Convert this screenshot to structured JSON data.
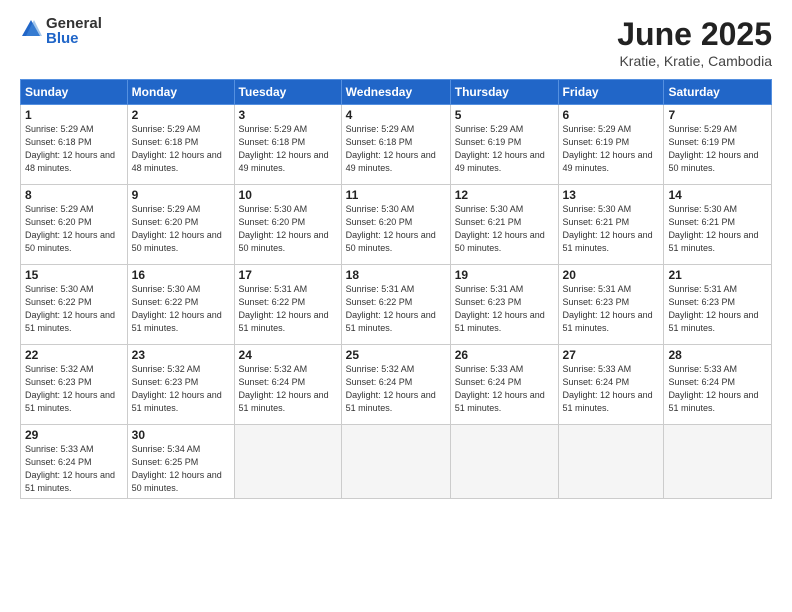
{
  "logo": {
    "general": "General",
    "blue": "Blue"
  },
  "title": "June 2025",
  "subtitle": "Kratie, Kratie, Cambodia",
  "headers": [
    "Sunday",
    "Monday",
    "Tuesday",
    "Wednesday",
    "Thursday",
    "Friday",
    "Saturday"
  ],
  "weeks": [
    [
      {
        "day": "1",
        "rise": "5:29 AM",
        "set": "6:18 PM",
        "daylight": "12 hours and 48 minutes."
      },
      {
        "day": "2",
        "rise": "5:29 AM",
        "set": "6:18 PM",
        "daylight": "12 hours and 48 minutes."
      },
      {
        "day": "3",
        "rise": "5:29 AM",
        "set": "6:18 PM",
        "daylight": "12 hours and 49 minutes."
      },
      {
        "day": "4",
        "rise": "5:29 AM",
        "set": "6:18 PM",
        "daylight": "12 hours and 49 minutes."
      },
      {
        "day": "5",
        "rise": "5:29 AM",
        "set": "6:19 PM",
        "daylight": "12 hours and 49 minutes."
      },
      {
        "day": "6",
        "rise": "5:29 AM",
        "set": "6:19 PM",
        "daylight": "12 hours and 49 minutes."
      },
      {
        "day": "7",
        "rise": "5:29 AM",
        "set": "6:19 PM",
        "daylight": "12 hours and 50 minutes."
      }
    ],
    [
      {
        "day": "8",
        "rise": "5:29 AM",
        "set": "6:20 PM",
        "daylight": "12 hours and 50 minutes."
      },
      {
        "day": "9",
        "rise": "5:29 AM",
        "set": "6:20 PM",
        "daylight": "12 hours and 50 minutes."
      },
      {
        "day": "10",
        "rise": "5:30 AM",
        "set": "6:20 PM",
        "daylight": "12 hours and 50 minutes."
      },
      {
        "day": "11",
        "rise": "5:30 AM",
        "set": "6:20 PM",
        "daylight": "12 hours and 50 minutes."
      },
      {
        "day": "12",
        "rise": "5:30 AM",
        "set": "6:21 PM",
        "daylight": "12 hours and 50 minutes."
      },
      {
        "day": "13",
        "rise": "5:30 AM",
        "set": "6:21 PM",
        "daylight": "12 hours and 51 minutes."
      },
      {
        "day": "14",
        "rise": "5:30 AM",
        "set": "6:21 PM",
        "daylight": "12 hours and 51 minutes."
      }
    ],
    [
      {
        "day": "15",
        "rise": "5:30 AM",
        "set": "6:22 PM",
        "daylight": "12 hours and 51 minutes."
      },
      {
        "day": "16",
        "rise": "5:30 AM",
        "set": "6:22 PM",
        "daylight": "12 hours and 51 minutes."
      },
      {
        "day": "17",
        "rise": "5:31 AM",
        "set": "6:22 PM",
        "daylight": "12 hours and 51 minutes."
      },
      {
        "day": "18",
        "rise": "5:31 AM",
        "set": "6:22 PM",
        "daylight": "12 hours and 51 minutes."
      },
      {
        "day": "19",
        "rise": "5:31 AM",
        "set": "6:23 PM",
        "daylight": "12 hours and 51 minutes."
      },
      {
        "day": "20",
        "rise": "5:31 AM",
        "set": "6:23 PM",
        "daylight": "12 hours and 51 minutes."
      },
      {
        "day": "21",
        "rise": "5:31 AM",
        "set": "6:23 PM",
        "daylight": "12 hours and 51 minutes."
      }
    ],
    [
      {
        "day": "22",
        "rise": "5:32 AM",
        "set": "6:23 PM",
        "daylight": "12 hours and 51 minutes."
      },
      {
        "day": "23",
        "rise": "5:32 AM",
        "set": "6:23 PM",
        "daylight": "12 hours and 51 minutes."
      },
      {
        "day": "24",
        "rise": "5:32 AM",
        "set": "6:24 PM",
        "daylight": "12 hours and 51 minutes."
      },
      {
        "day": "25",
        "rise": "5:32 AM",
        "set": "6:24 PM",
        "daylight": "12 hours and 51 minutes."
      },
      {
        "day": "26",
        "rise": "5:33 AM",
        "set": "6:24 PM",
        "daylight": "12 hours and 51 minutes."
      },
      {
        "day": "27",
        "rise": "5:33 AM",
        "set": "6:24 PM",
        "daylight": "12 hours and 51 minutes."
      },
      {
        "day": "28",
        "rise": "5:33 AM",
        "set": "6:24 PM",
        "daylight": "12 hours and 51 minutes."
      }
    ],
    [
      {
        "day": "29",
        "rise": "5:33 AM",
        "set": "6:24 PM",
        "daylight": "12 hours and 51 minutes."
      },
      {
        "day": "30",
        "rise": "5:34 AM",
        "set": "6:25 PM",
        "daylight": "12 hours and 50 minutes."
      },
      null,
      null,
      null,
      null,
      null
    ]
  ]
}
